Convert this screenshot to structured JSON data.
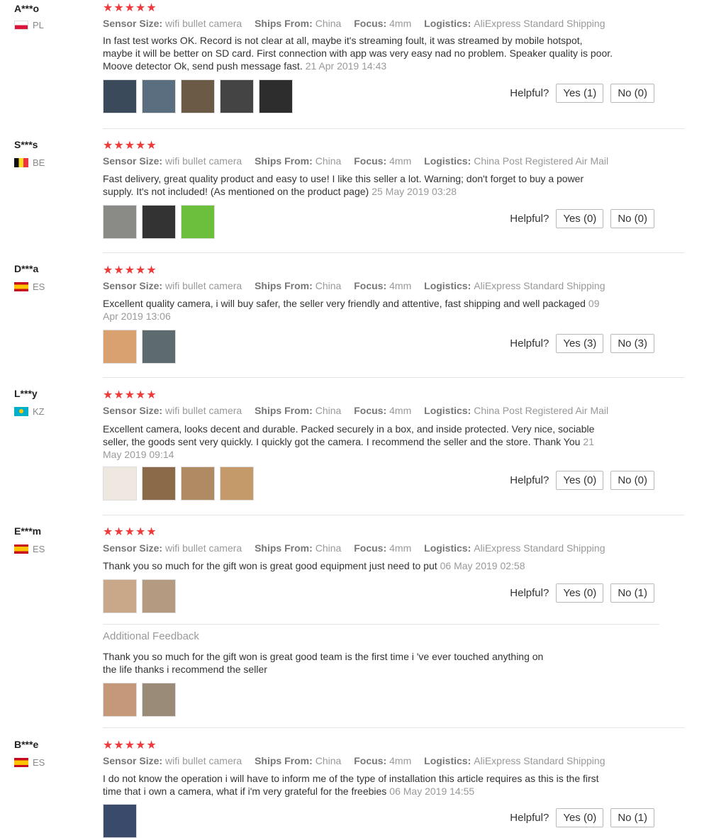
{
  "labels": {
    "sensor": "Sensor Size:",
    "ships": "Ships From:",
    "focus": "Focus:",
    "logistics": "Logistics:",
    "helpful": "Helpful?",
    "additional": "Additional Feedback",
    "stars": "★★★★★"
  },
  "reviews": [
    {
      "user": "A***o",
      "country": "PL",
      "sensor": "wifi bullet camera",
      "ships": "China",
      "focus": "4mm",
      "logistics": "AliExpress Standard Shipping",
      "text": "In fast test works OK. Record is not clear at all, maybe it's streaming foult, it was streamed by mobile hotspot, maybe it will be better on SD card. First connection with app was very easy nad no problem. Speaker quality is poor. Moove detector Ok, send push message fast.",
      "date": "21 Apr 2019 14:43",
      "yes": "Yes (1)",
      "no": "No (0)"
    },
    {
      "user": "S***s",
      "country": "BE",
      "sensor": "wifi bullet camera",
      "ships": "China",
      "focus": "4mm",
      "logistics": "China Post Registered Air Mail",
      "text": "Fast delivery, great quality product and easy to use! I like this seller a lot. Warning; don't forget to buy a power supply. It's not included! (As mentioned on the product page)",
      "date": "25 May 2019 03:28",
      "yes": "Yes (0)",
      "no": "No (0)"
    },
    {
      "user": "D***a",
      "country": "ES",
      "sensor": "wifi bullet camera",
      "ships": "China",
      "focus": "4mm",
      "logistics": "AliExpress Standard Shipping",
      "text": "Excellent quality camera, i will buy safer, the seller very friendly and attentive, fast shipping and well packaged",
      "date": "09 Apr 2019 13:06",
      "yes": "Yes (3)",
      "no": "No (3)"
    },
    {
      "user": "L***y",
      "country": "KZ",
      "sensor": "wifi bullet camera",
      "ships": "China",
      "focus": "4mm",
      "logistics": "China Post Registered Air Mail",
      "text": "Excellent camera, looks decent and durable. Packed securely in a box, and inside protected. Very nice, sociable seller, the goods sent very quickly. I quickly got the camera. I recommend the seller and the store. Thank You",
      "date": "21 May 2019 09:14",
      "yes": "Yes (0)",
      "no": "No (0)"
    },
    {
      "user": "E***m",
      "country": "ES",
      "sensor": "wifi bullet camera",
      "ships": "China",
      "focus": "4mm",
      "logistics": "AliExpress Standard Shipping",
      "text": "Thank you so much for the gift won is great good equipment just need to put",
      "date": "06 May 2019 02:58",
      "yes": "Yes (0)",
      "no": "No (1)",
      "additional_text": "Thank you so much for the gift won is great good team is the first time i 've ever touched anything on the life thanks i recommend the seller"
    },
    {
      "user": "B***e",
      "country": "ES",
      "sensor": "wifi bullet camera",
      "ships": "China",
      "focus": "4mm",
      "logistics": "AliExpress Standard Shipping",
      "text": "I do not know the operation i will have to inform me of the type of installation this article requires as this is the first time that i own a camera, what if i'm very grateful for the freebies",
      "date": "06 May 2019 14:55",
      "yes": "Yes (0)",
      "no": "No (1)"
    }
  ],
  "colors": {
    "star": "#f0393a",
    "thumbs": [
      [
        "#3b4a5a",
        "#5a6e80",
        "#6b5a45",
        "#444444",
        "#2d2d2d"
      ],
      [
        "#8a8a86",
        "#333333",
        "#6cbf3c"
      ],
      [
        "#d9a070",
        "#5d6a70"
      ],
      [
        "#efe8e0",
        "#8a6a48",
        "#b08a62",
        "#c49a6a"
      ],
      [
        "#c9a88a",
        "#b49a80"
      ],
      [
        "#c49878",
        "#9a8a78"
      ],
      [
        "#3a4a6a"
      ]
    ]
  }
}
